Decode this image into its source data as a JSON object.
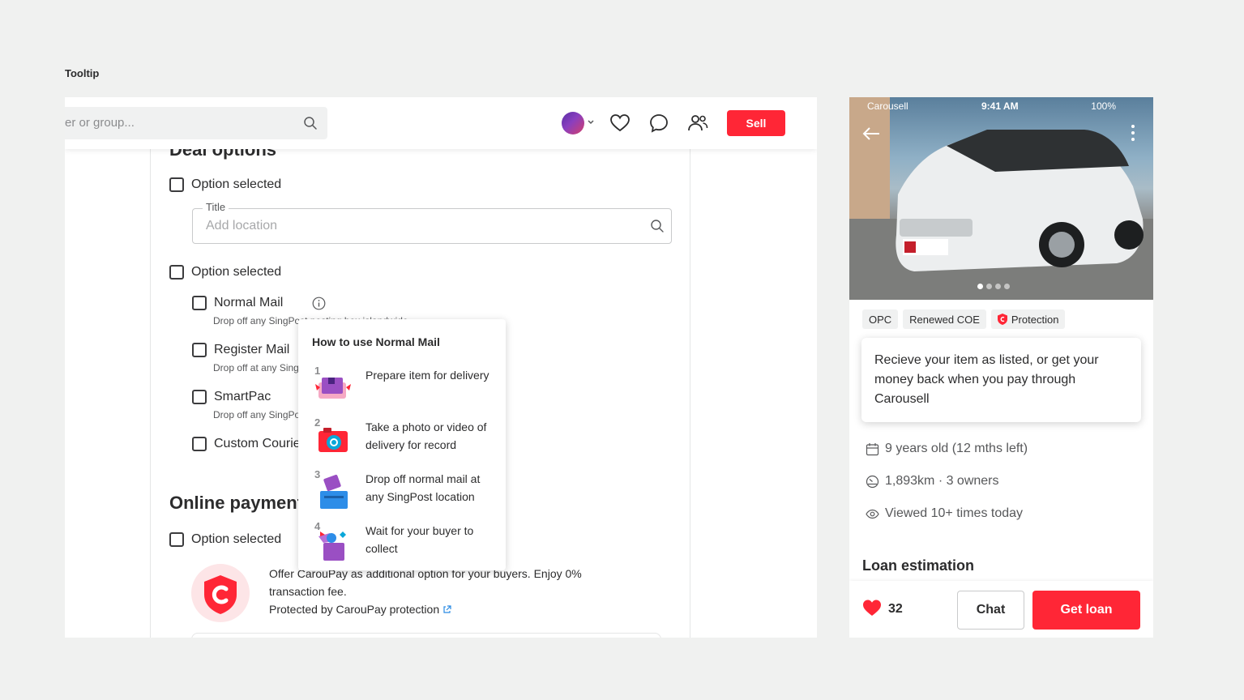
{
  "page": {
    "label": "Tooltip"
  },
  "desktop": {
    "search": {
      "text": "er or group...",
      "icon": "search-icon"
    },
    "nav": {
      "icons": [
        "avatar",
        "heart-icon",
        "chat-bubble-icon",
        "people-icon"
      ],
      "sell_label": "Sell"
    },
    "deal_options": {
      "title": "Deal options",
      "option1": "Option selected",
      "field": {
        "legend": "Title",
        "placeholder": "Add location"
      },
      "option2": "Option selected",
      "mail_options": [
        {
          "label": "Normal Mail",
          "sub": "Drop off any SingPost posting box islandwide"
        },
        {
          "label": "Register Mail",
          "sub": "Drop off at any SingPost"
        },
        {
          "label": "SmartPac",
          "sub": "Drop off any SingPost"
        },
        {
          "label": "Custom Courier",
          "sub": ""
        }
      ]
    },
    "tooltip": {
      "title": "How to use Normal Mail",
      "steps": [
        {
          "num": "1",
          "text": "Prepare item for delivery"
        },
        {
          "num": "2",
          "text": "Take a photo or video of delivery for record"
        },
        {
          "num": "3",
          "text": "Drop off normal mail at any SingPost location"
        },
        {
          "num": "4",
          "text": "Wait for your buyer to collect"
        }
      ]
    },
    "online_payment": {
      "title": "Online payment",
      "option": "Option selected",
      "desc": "Offer CarouPay as additional option for your buyers. Enjoy 0% transaction fee.",
      "protection": "Protected by CarouPay protection"
    },
    "colors": {
      "accent": "#ff2636",
      "link": "#2a8be4"
    }
  },
  "mobile": {
    "status": {
      "carrier": "Carousell",
      "time": "9:41 AM",
      "battery": "100%"
    },
    "tags": [
      "OPC",
      "Renewed COE",
      "Protection"
    ],
    "tooltip_text": "Recieve your item as listed, or get your money back when you pay through Carousell",
    "specs": [
      {
        "icon": "calendar-icon",
        "text": "9 years old (12 mths left)"
      },
      {
        "icon": "gauge-icon",
        "text": "1,893km · 3 owners"
      },
      {
        "icon": "eye-icon",
        "text": "Viewed 10+ times today"
      }
    ],
    "loan_title": "Loan estimation",
    "likes": "32",
    "chat_label": "Chat",
    "loan_label": "Get loan"
  }
}
